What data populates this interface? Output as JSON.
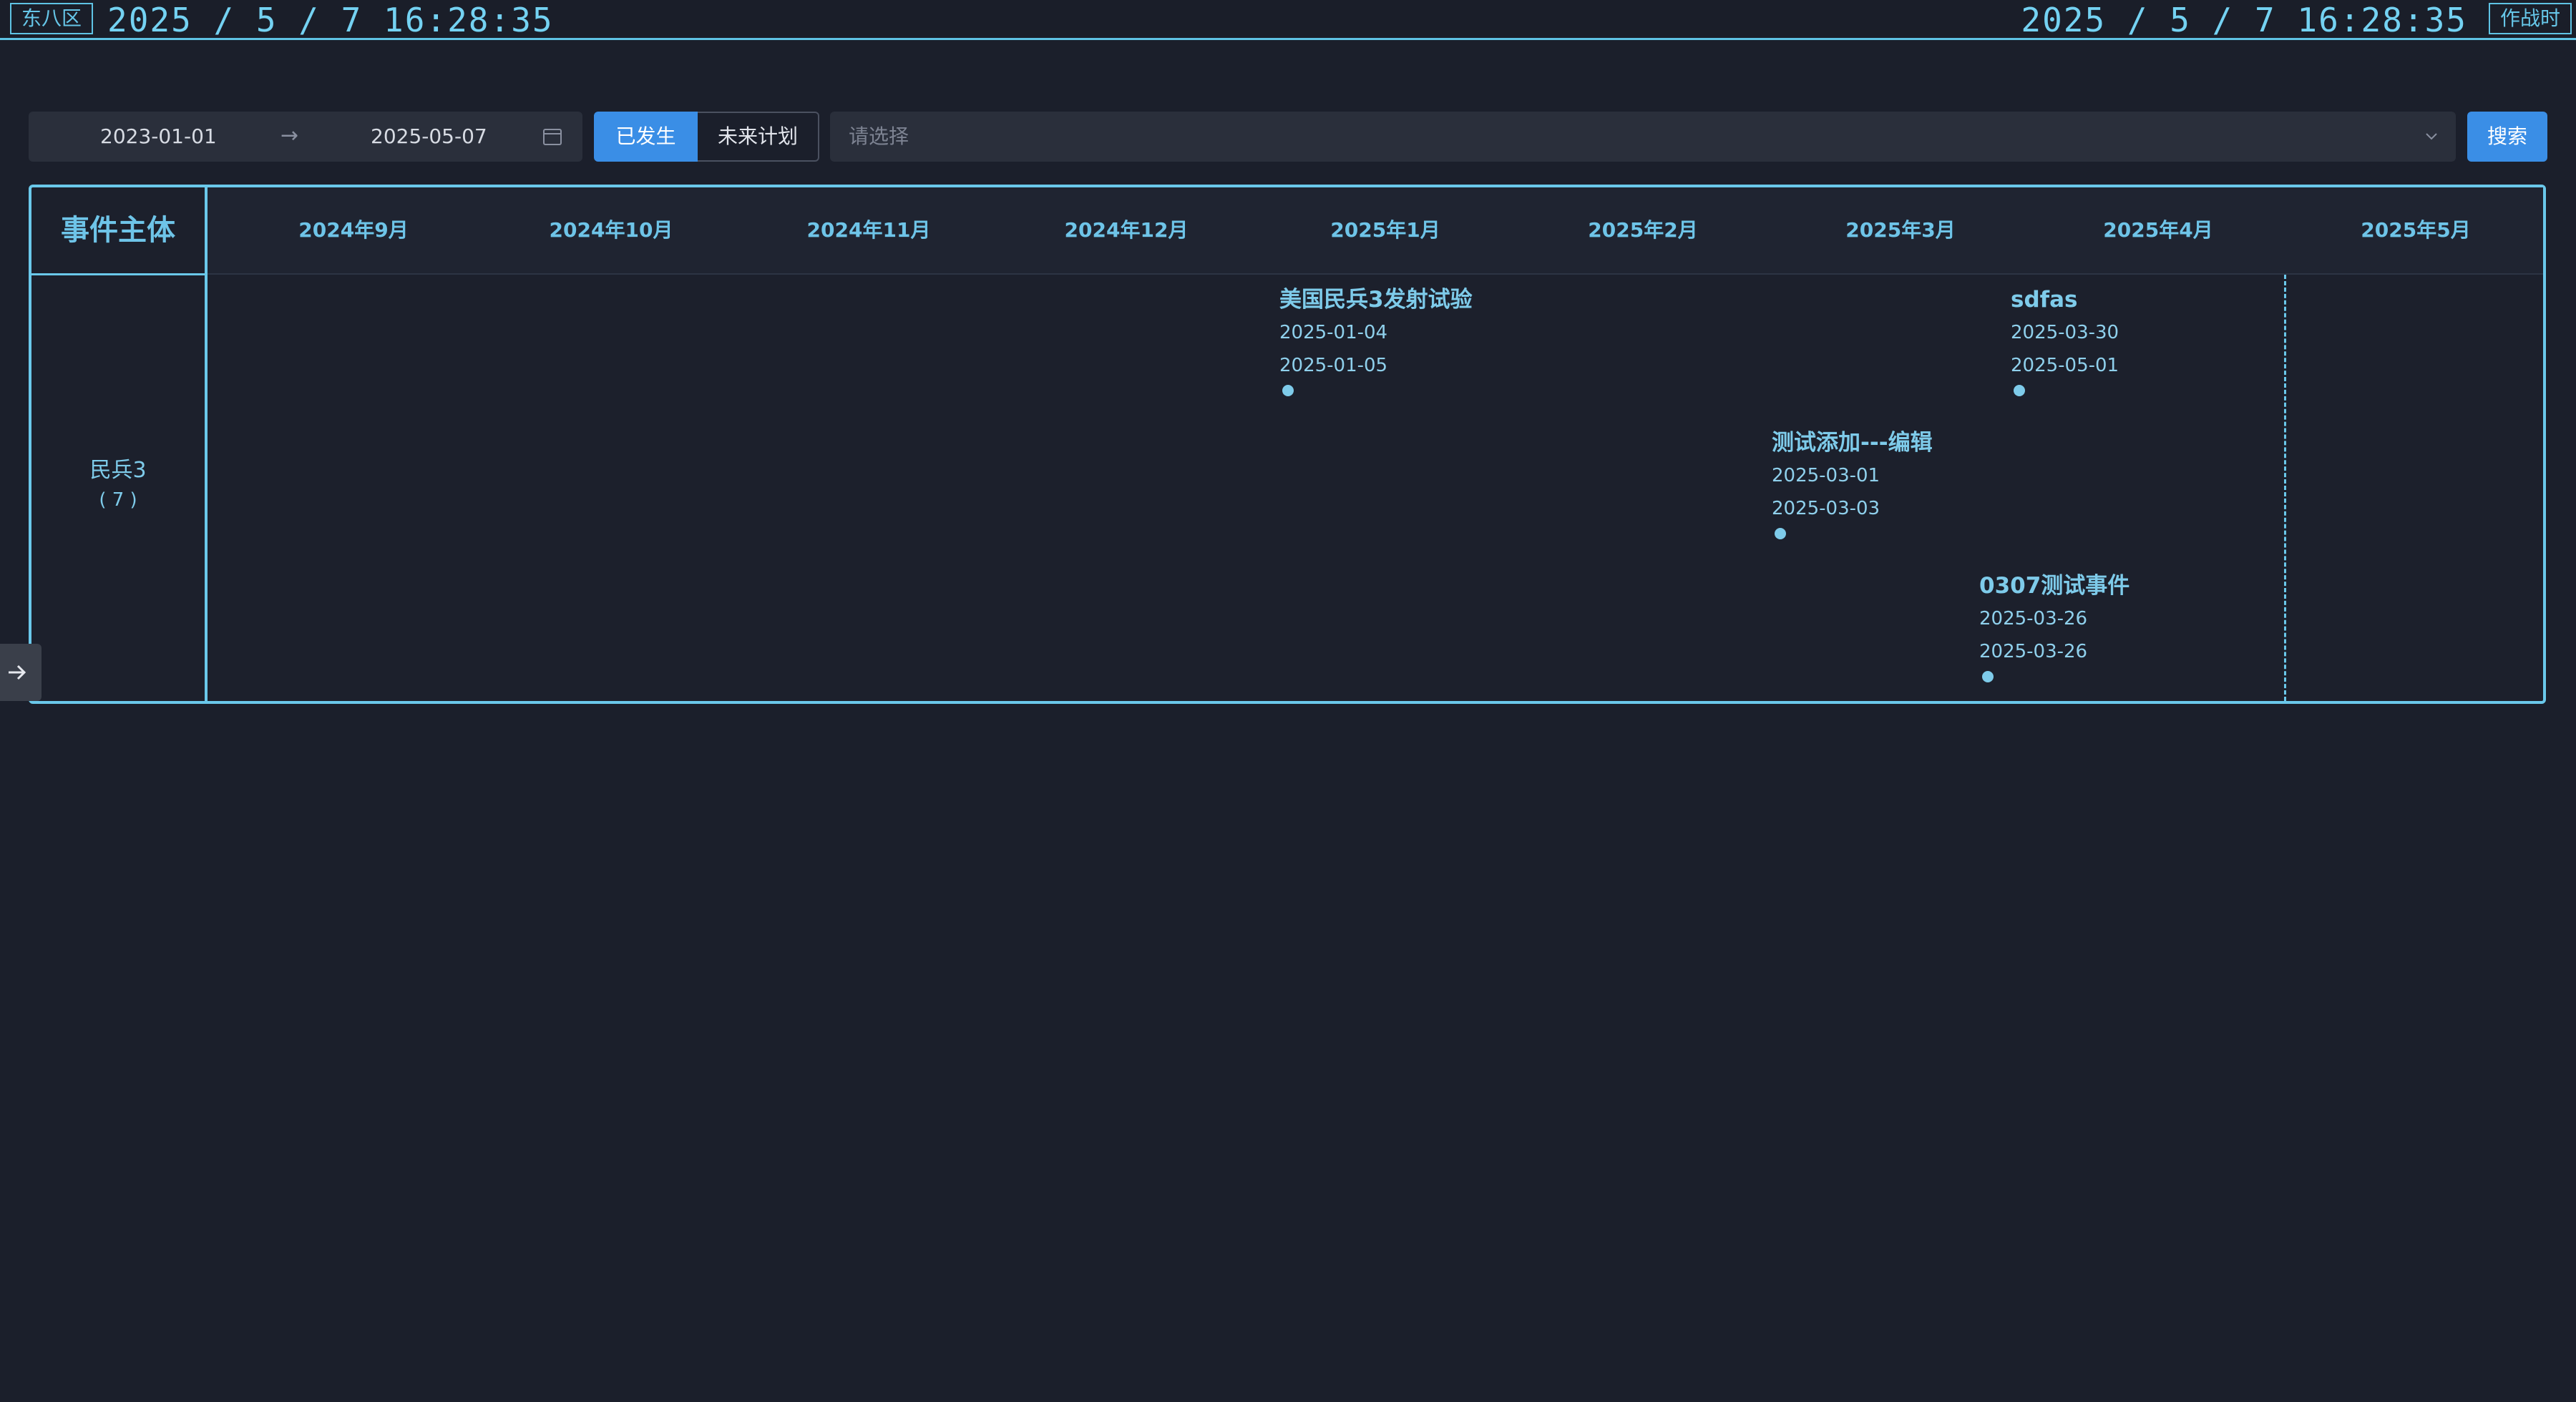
{
  "topbar": {
    "tz_label": "东八区",
    "clock_left": "2025 / 5 / 7 16:28:35",
    "clock_right": "2025 / 5 / 7 16:28:35",
    "mode_label": "作战时"
  },
  "filters": {
    "date_start": "2023-01-01",
    "date_end": "2025-05-07",
    "range_arrow": "→",
    "segment_occurred": "已发生",
    "segment_future": "未来计划",
    "segment_selected": "已发生",
    "select_placeholder": "请选择",
    "search_label": "搜索"
  },
  "timeline": {
    "subject_header": "事件主体",
    "months": [
      "2024年9月",
      "2024年10月",
      "2024年11月",
      "2024年12月",
      "2025年1月",
      "2025年2月",
      "2025年3月",
      "2025年4月",
      "2025年5月"
    ],
    "subject": {
      "name": "民兵3",
      "count": "( 7 )"
    },
    "events": [
      {
        "title": "美国民兵3发射试验",
        "start": "2025-01-04",
        "end": "2025-01-05"
      },
      {
        "title": "sdfas",
        "start": "2025-03-30",
        "end": "2025-05-01"
      },
      {
        "title": "测试添加---编辑",
        "start": "2025-03-01",
        "end": "2025-03-03"
      },
      {
        "title": "0307测试事件",
        "start": "2025-03-26",
        "end": "2025-03-26"
      }
    ]
  },
  "colors": {
    "accent": "#6ac8ea",
    "primary_button": "#3a8ee6",
    "background": "#1b1f2b"
  },
  "icons": {
    "calendar": "calendar-icon",
    "chevron": "chevron-down-icon",
    "side_toggle": "arrow-right-icon"
  }
}
